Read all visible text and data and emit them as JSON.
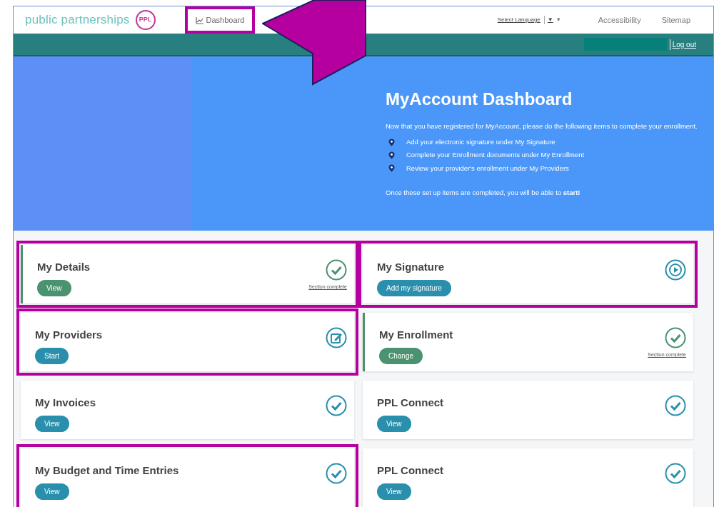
{
  "header": {
    "logo": {
      "text": "public partnerships",
      "badge": "PPL"
    },
    "nav": [
      {
        "label": "Dashboard",
        "highlighted": true
      }
    ],
    "language": {
      "label": "Select Language",
      "icon": "▼",
      "caret": "▾"
    },
    "links": [
      "Accessibility",
      "Sitemap"
    ]
  },
  "account_bar": {
    "logout": "Log out"
  },
  "hero": {
    "title": "MyAccount Dashboard",
    "intro": "Now that you have registered for MyAccount, please do the following items to complete your enrollment.",
    "steps": [
      "Add your electronic signature under My Signature",
      "Complete your Enrollment documents under My Enrollment",
      "Review your provider's enrollment under My Providers"
    ],
    "outro": "Once these set up items are completed, you will be able to **start!**"
  },
  "cards": [
    {
      "title": "My Details",
      "button": "View",
      "kind": "complete",
      "status_label": "Section complete",
      "highlighted": true
    },
    {
      "title": "My Signature",
      "button": "Add my signature",
      "kind": "start",
      "highlighted": true
    },
    {
      "title": "My Providers",
      "button": "Start",
      "kind": "edit",
      "highlighted": true
    },
    {
      "title": "My Enrollment",
      "button": "Change",
      "kind": "complete",
      "status_label": "Section complete",
      "highlighted": false
    },
    {
      "title": "My Invoices",
      "button": "View",
      "kind": "done",
      "highlighted": false
    },
    {
      "title": "PPL Connect",
      "button": "View",
      "kind": "done",
      "highlighted": false
    },
    {
      "title": "My Budget and Time Entries",
      "button": "View",
      "kind": "done",
      "highlighted": true
    },
    {
      "title": "PPL Connect",
      "button": "View",
      "kind": "done",
      "highlighted": false
    }
  ],
  "callout_arrow": true
}
